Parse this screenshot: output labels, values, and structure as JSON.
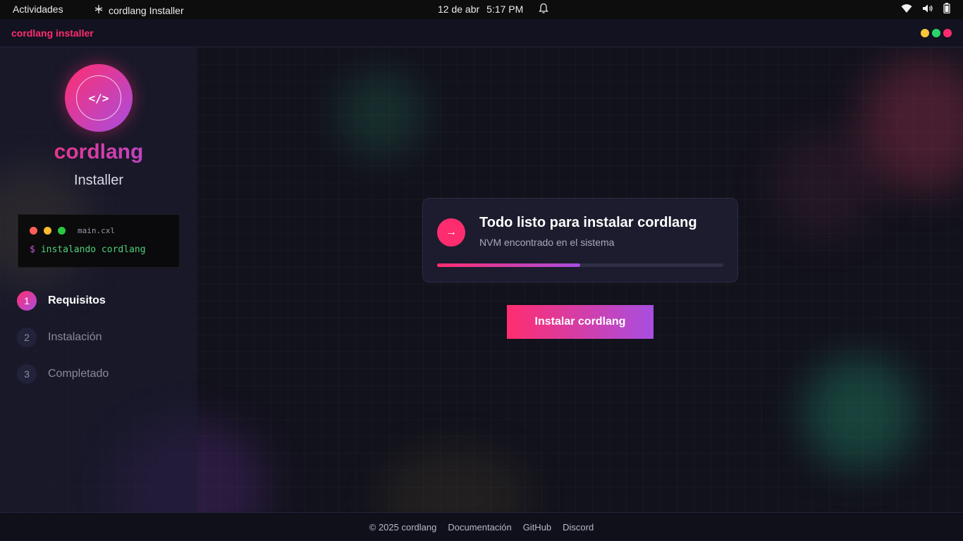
{
  "topbar": {
    "activities": "Actividades",
    "app_title": "cordlang Installer",
    "date": "12 de abr",
    "time": "5:17 PM"
  },
  "header": {
    "brand": "cordlang installer",
    "window_dots": [
      "#f6c83a",
      "#2bd46a",
      "#ff2d6f"
    ]
  },
  "sidebar": {
    "logo_text": "</>",
    "title": "cordlang",
    "subtitle": "Installer",
    "terminal": {
      "filename": "main.cxl",
      "prompt": "$",
      "command": "instalando cordlang"
    },
    "steps": [
      {
        "number": "1",
        "label": "Requisitos",
        "state": "active"
      },
      {
        "number": "2",
        "label": "Instalación",
        "state": "pending"
      },
      {
        "number": "3",
        "label": "Completado",
        "state": "pending"
      }
    ]
  },
  "card": {
    "icon": "→",
    "title": "Todo listo para instalar cordlang",
    "subtitle": "NVM encontrado en el sistema",
    "progress": 0.5
  },
  "install_button": "Instalar cordlang",
  "footer": {
    "copyright": "© 2025 cordlang",
    "links": [
      "Documentación",
      "GitHub",
      "Discord"
    ]
  },
  "colors": {
    "accent_pink": "#ff2d6f",
    "accent_purple": "#a84ee0",
    "terminal_green": "#4ed07a"
  }
}
